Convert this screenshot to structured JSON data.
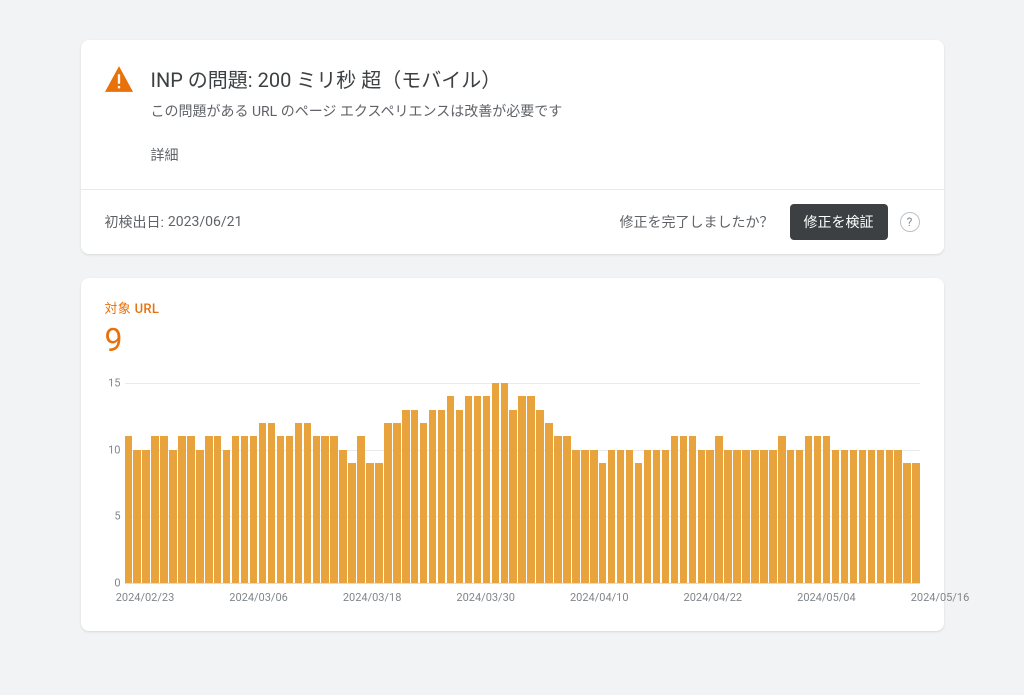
{
  "issue": {
    "title": "INP の問題: 200 ミリ秒 超（モバイル）",
    "subtitle": "この問題がある URL のページ エクスペリエンスは改善が必要です",
    "details_link": "詳細"
  },
  "issue_footer": {
    "first_detected_label": "初検出日:",
    "first_detected_date": "2023/06/21",
    "fix_question": "修正を完了しましたか？",
    "validate_button": "修正を検証",
    "help_glyph": "?"
  },
  "chart": {
    "label": "対象 URL",
    "current_value": "9"
  },
  "chart_data": {
    "type": "bar",
    "title": "対象 URL",
    "xlabel": "",
    "ylabel": "",
    "ylim": [
      0,
      15
    ],
    "y_ticks": [
      0,
      5,
      10,
      15
    ],
    "x_ticks": [
      "2024/02/23",
      "2024/03/06",
      "2024/03/18",
      "2024/03/30",
      "2024/04/10",
      "2024/04/22",
      "2024/05/04",
      "2024/05/16"
    ],
    "categories": [
      "2024/02/23",
      "2024/02/24",
      "2024/02/25",
      "2024/02/26",
      "2024/02/27",
      "2024/02/28",
      "2024/02/29",
      "2024/03/01",
      "2024/03/02",
      "2024/03/03",
      "2024/03/04",
      "2024/03/05",
      "2024/03/06",
      "2024/03/07",
      "2024/03/08",
      "2024/03/09",
      "2024/03/10",
      "2024/03/11",
      "2024/03/12",
      "2024/03/13",
      "2024/03/14",
      "2024/03/15",
      "2024/03/16",
      "2024/03/17",
      "2024/03/18",
      "2024/03/19",
      "2024/03/20",
      "2024/03/21",
      "2024/03/22",
      "2024/03/23",
      "2024/03/24",
      "2024/03/25",
      "2024/03/26",
      "2024/03/27",
      "2024/03/28",
      "2024/03/29",
      "2024/03/30",
      "2024/03/31",
      "2024/04/01",
      "2024/04/02",
      "2024/04/03",
      "2024/04/04",
      "2024/04/05",
      "2024/04/06",
      "2024/04/07",
      "2024/04/08",
      "2024/04/09",
      "2024/04/10",
      "2024/04/11",
      "2024/04/12",
      "2024/04/13",
      "2024/04/14",
      "2024/04/15",
      "2024/04/16",
      "2024/04/17",
      "2024/04/18",
      "2024/04/19",
      "2024/04/20",
      "2024/04/21",
      "2024/04/22",
      "2024/04/23",
      "2024/04/24",
      "2024/04/25",
      "2024/04/26",
      "2024/04/27",
      "2024/04/28",
      "2024/04/29",
      "2024/04/30",
      "2024/05/01",
      "2024/05/02",
      "2024/05/03",
      "2024/05/04",
      "2024/05/05",
      "2024/05/06",
      "2024/05/07",
      "2024/05/08",
      "2024/05/09",
      "2024/05/10",
      "2024/05/11",
      "2024/05/12",
      "2024/05/13",
      "2024/05/14",
      "2024/05/15",
      "2024/05/16",
      "2024/05/17",
      "2024/05/18",
      "2024/05/19",
      "2024/05/20",
      "2024/05/21"
    ],
    "values": [
      11,
      10,
      10,
      11,
      11,
      10,
      11,
      11,
      10,
      11,
      11,
      10,
      11,
      11,
      11,
      12,
      12,
      11,
      11,
      12,
      12,
      11,
      11,
      11,
      10,
      9,
      11,
      9,
      9,
      12,
      12,
      13,
      13,
      12,
      13,
      13,
      14,
      13,
      14,
      14,
      14,
      15,
      15,
      13,
      14,
      14,
      13,
      12,
      11,
      11,
      10,
      10,
      10,
      9,
      10,
      10,
      10,
      9,
      10,
      10,
      10,
      11,
      11,
      11,
      10,
      10,
      11,
      10,
      10,
      10,
      10,
      10,
      10,
      11,
      10,
      10,
      11,
      11,
      11,
      10,
      10,
      10,
      10,
      10,
      10,
      10,
      10,
      9,
      9
    ]
  },
  "colors": {
    "accent": "#e8710a",
    "bar": "#e8a33d"
  }
}
